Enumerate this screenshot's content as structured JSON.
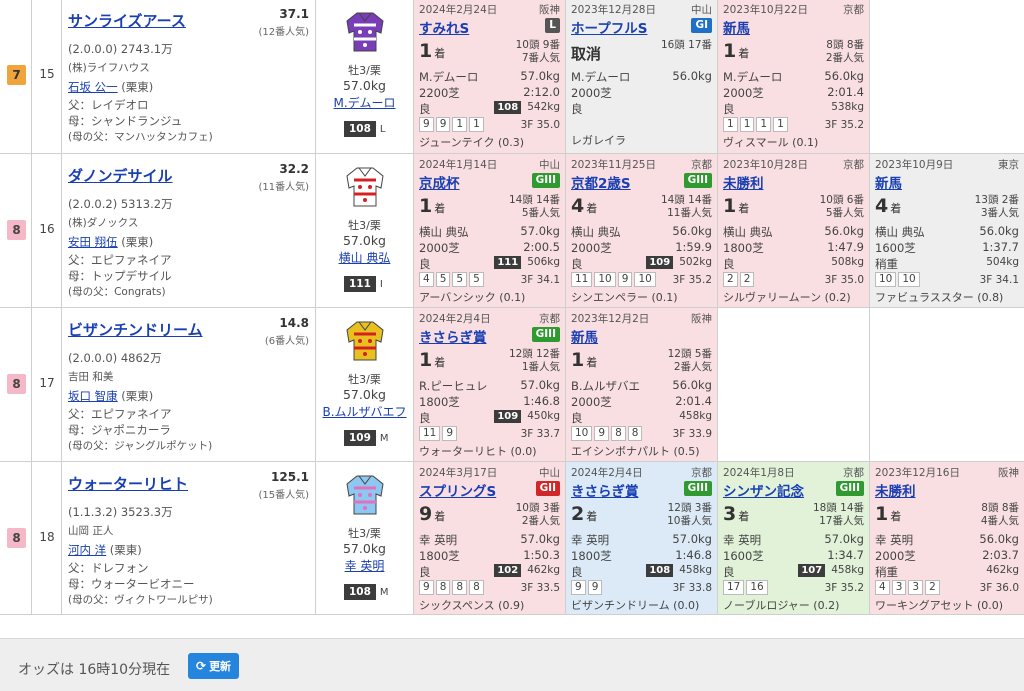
{
  "horses": [
    {
      "waku": "7",
      "umaban": "15",
      "name": "サンライズアース",
      "odds": "37.1",
      "ninki": "(12番人気)",
      "record": "(2.0.0.0) 2743.1万",
      "owner": "(株)ライフハウス",
      "trainer": "石坂 公一",
      "stable": " (栗東)",
      "sire": "父：レイデオロ",
      "dam": "母：シャンドランジュ",
      "damsire": "(母の父：マンハッタンカフェ)",
      "sexage": "牡3/栗",
      "weight": "57.0kg",
      "jockey": "M.デムーロ",
      "rating": "108",
      "rank": "L",
      "past": [
        {
          "date": "2024年2月24日",
          "venue": "阪神",
          "race": "すみれS",
          "grade": "L",
          "finish": "1",
          "chaku": "着",
          "field1": "10頭 9番",
          "field2": "7番人気",
          "jockey": "M.デムーロ",
          "kg": "57.0kg",
          "dist": "2200芝",
          "time": "2:12.0",
          "cond": "良",
          "speed": "108",
          "hw": "542kg",
          "corners": [
            "9",
            "9",
            "1",
            "1"
          ],
          "last3f": "3F 35.0",
          "winner": "ジューンテイク (0.3)"
        },
        {
          "date": "2023年12月28日",
          "venue": "中山",
          "race": "ホープフルS",
          "grade": "GI",
          "finish": "取消",
          "chaku": "",
          "field1": "16頭 17番",
          "field2": "",
          "jockey": "M.デムーロ",
          "kg": "56.0kg",
          "dist": "2000芝",
          "time": "",
          "cond": "良",
          "speed": "",
          "hw": "",
          "corners": [],
          "last3f": "",
          "winner": "レガレイラ"
        },
        {
          "date": "2023年10月22日",
          "venue": "京都",
          "race": "新馬",
          "grade": "",
          "finish": "1",
          "chaku": "着",
          "field1": "8頭 8番",
          "field2": "2番人気",
          "jockey": "M.デムーロ",
          "kg": "56.0kg",
          "dist": "2000芝",
          "time": "2:01.4",
          "cond": "良",
          "speed": "",
          "hw": "538kg",
          "corners": [
            "1",
            "1",
            "1",
            "1"
          ],
          "last3f": "3F 35.2",
          "winner": "ヴィスマール (0.1)"
        },
        null
      ]
    },
    {
      "waku": "8",
      "umaban": "16",
      "name": "ダノンデサイル",
      "odds": "32.2",
      "ninki": "(11番人気)",
      "record": "(2.0.0.2) 5313.2万",
      "owner": "(株)ダノックス",
      "trainer": "安田 翔伍",
      "stable": " (栗東)",
      "sire": "父：エピファネイア",
      "dam": "母：トップデサイル",
      "damsire": "(母の父：Congrats)",
      "sexage": "牡3/栗",
      "weight": "57.0kg",
      "jockey": "横山 典弘",
      "rating": "111",
      "rank": "I",
      "past": [
        {
          "date": "2024年1月14日",
          "venue": "中山",
          "race": "京成杯",
          "grade": "GIII",
          "finish": "1",
          "chaku": "着",
          "field1": "14頭 14番",
          "field2": "5番人気",
          "jockey": "横山 典弘",
          "kg": "57.0kg",
          "dist": "2000芝",
          "time": "2:00.5",
          "cond": "良",
          "speed": "111",
          "hw": "506kg",
          "corners": [
            "4",
            "5",
            "5",
            "5"
          ],
          "last3f": "3F 34.1",
          "winner": "アーバンシック (0.1)"
        },
        {
          "date": "2023年11月25日",
          "venue": "京都",
          "race": "京都2歳S",
          "grade": "GIII",
          "finish": "4",
          "chaku": "着",
          "field1": "14頭 14番",
          "field2": "11番人気",
          "jockey": "横山 典弘",
          "kg": "56.0kg",
          "dist": "2000芝",
          "time": "1:59.9",
          "cond": "良",
          "speed": "109",
          "hw": "502kg",
          "corners": [
            "11",
            "10",
            "9",
            "10"
          ],
          "last3f": "3F 35.2",
          "winner": "シンエンペラー (0.1)"
        },
        {
          "date": "2023年10月28日",
          "venue": "京都",
          "race": "未勝利",
          "grade": "",
          "finish": "1",
          "chaku": "着",
          "field1": "10頭 6番",
          "field2": "5番人気",
          "jockey": "横山 典弘",
          "kg": "56.0kg",
          "dist": "1800芝",
          "time": "1:47.9",
          "cond": "良",
          "speed": "",
          "hw": "508kg",
          "corners": [
            "2",
            "2"
          ],
          "last3f": "3F 35.0",
          "winner": "シルヴァリームーン (0.2)"
        },
        {
          "date": "2023年10月9日",
          "venue": "東京",
          "race": "新馬",
          "grade": "",
          "finish": "4",
          "chaku": "着",
          "field1": "13頭 2番",
          "field2": "3番人気",
          "jockey": "横山 典弘",
          "kg": "56.0kg",
          "dist": "1600芝",
          "time": "1:37.7",
          "cond": "稍重",
          "speed": "",
          "hw": "504kg",
          "corners": [
            "10",
            "10"
          ],
          "last3f": "3F 34.1",
          "winner": "ファビュラススター (0.8)"
        }
      ]
    },
    {
      "waku": "8",
      "umaban": "17",
      "name": "ビザンチンドリーム",
      "odds": "14.8",
      "ninki": "(6番人気)",
      "record": "(2.0.0.0) 4862万",
      "owner": "吉田 和美",
      "trainer": "坂口 智康",
      "stable": " (栗東)",
      "sire": "父：エピファネイア",
      "dam": "母：ジャポニカーラ",
      "damsire": "(母の父：ジャングルポケット)",
      "sexage": "牡3/栗",
      "weight": "57.0kg",
      "jockey": "B.ムルザバエフ",
      "rating": "109",
      "rank": "M",
      "past": [
        {
          "date": "2024年2月4日",
          "venue": "京都",
          "race": "きさらぎ賞",
          "grade": "GIII",
          "finish": "1",
          "chaku": "着",
          "field1": "12頭 12番",
          "field2": "1番人気",
          "jockey": "R.ピーヒュレ",
          "kg": "57.0kg",
          "dist": "1800芝",
          "time": "1:46.8",
          "cond": "良",
          "speed": "109",
          "hw": "450kg",
          "corners": [
            "11",
            "9"
          ],
          "last3f": "3F 33.7",
          "winner": "ウォーターリヒト (0.0)"
        },
        {
          "date": "2023年12月2日",
          "venue": "阪神",
          "race": "新馬",
          "grade": "",
          "finish": "1",
          "chaku": "着",
          "field1": "12頭 5番",
          "field2": "2番人気",
          "jockey": "B.ムルザバエ",
          "kg": "56.0kg",
          "dist": "2000芝",
          "time": "2:01.4",
          "cond": "良",
          "speed": "",
          "hw": "458kg",
          "corners": [
            "10",
            "9",
            "8",
            "8"
          ],
          "last3f": "3F 33.9",
          "winner": "エイシンボナパルト (0.5)"
        },
        null,
        null
      ]
    },
    {
      "waku": "8",
      "umaban": "18",
      "name": "ウォーターリヒト",
      "odds": "125.1",
      "ninki": "(15番人気)",
      "record": "(1.1.3.2) 3523.3万",
      "owner": "山岡 正人",
      "trainer": "河内 洋",
      "stable": " (栗東)",
      "sire": "父：ドレフォン",
      "dam": "母：ウォータービオニー",
      "damsire": "(母の父：ヴィクトワールピサ)",
      "sexage": "牡3/栗",
      "weight": "57.0kg",
      "jockey": "幸 英明",
      "rating": "108",
      "rank": "M",
      "past": [
        {
          "date": "2024年3月17日",
          "venue": "中山",
          "race": "スプリングS",
          "grade": "GII",
          "finish": "9",
          "chaku": "着",
          "field1": "10頭 3番",
          "field2": "2番人気",
          "jockey": "幸 英明",
          "kg": "57.0kg",
          "dist": "1800芝",
          "time": "1:50.3",
          "cond": "良",
          "speed": "102",
          "hw": "462kg",
          "corners": [
            "9",
            "8",
            "8",
            "8"
          ],
          "last3f": "3F 33.5",
          "winner": "シックスペンス (0.9)"
        },
        {
          "date": "2024年2月4日",
          "venue": "京都",
          "race": "きさらぎ賞",
          "grade": "GIII",
          "finish": "2",
          "chaku": "着",
          "field1": "12頭 3番",
          "field2": "10番人気",
          "jockey": "幸 英明",
          "kg": "57.0kg",
          "dist": "1800芝",
          "time": "1:46.8",
          "cond": "良",
          "speed": "108",
          "hw": "458kg",
          "corners": [
            "9",
            "9"
          ],
          "last3f": "3F 33.8",
          "winner": "ビザンチンドリーム (0.0)"
        },
        {
          "date": "2024年1月8日",
          "venue": "京都",
          "race": "シンザン記念",
          "grade": "GIII",
          "finish": "3",
          "chaku": "着",
          "field1": "18頭 14番",
          "field2": "17番人気",
          "jockey": "幸 英明",
          "kg": "57.0kg",
          "dist": "1600芝",
          "time": "1:34.7",
          "cond": "良",
          "speed": "107",
          "hw": "458kg",
          "corners": [
            "17",
            "16"
          ],
          "last3f": "3F 35.2",
          "winner": "ノーブルロジャー (0.2)"
        },
        {
          "date": "2023年12月16日",
          "venue": "阪神",
          "race": "未勝利",
          "grade": "",
          "finish": "1",
          "chaku": "着",
          "field1": "8頭 8番",
          "field2": "4番人気",
          "jockey": "幸 英明",
          "kg": "56.0kg",
          "dist": "2000芝",
          "time": "2:03.7",
          "cond": "稍重",
          "speed": "",
          "hw": "462kg",
          "corners": [
            "4",
            "3",
            "3",
            "2"
          ],
          "last3f": "3F 36.0",
          "winner": "ワーキングアセット (0.0)"
        }
      ]
    }
  ],
  "past_bg": [
    [
      "pink",
      "grey",
      "pink",
      "white"
    ],
    [
      "pink",
      "pink",
      "pink",
      "grey"
    ],
    [
      "pink",
      "pink",
      "white",
      "white"
    ],
    [
      "pink",
      "blue",
      "green",
      "pink"
    ]
  ],
  "footer": {
    "odds_time": "オッズは 16時10分現在",
    "refresh_label": "更新",
    "refresh_icon": "refresh-icon"
  },
  "silk_colors": [
    {
      "body": "#7a3db8",
      "accent": "#ffffff"
    },
    {
      "body": "#ffffff",
      "accent": "#d42020"
    },
    {
      "body": "#e8c020",
      "accent": "#d42020"
    },
    {
      "body": "#8ec8f0",
      "accent": "#e070c0"
    }
  ]
}
